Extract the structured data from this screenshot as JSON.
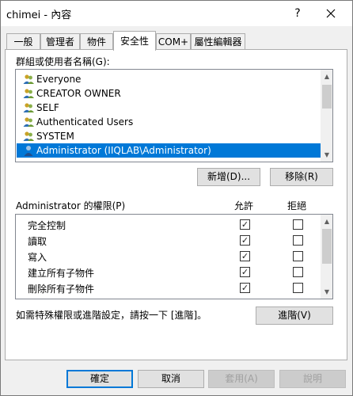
{
  "window": {
    "title": "chimei - 內容",
    "help_glyph": "?",
    "close_glyph": "✕"
  },
  "tabs": [
    {
      "label": "一般",
      "active": false
    },
    {
      "label": "管理者",
      "active": false
    },
    {
      "label": "物件",
      "active": false
    },
    {
      "label": "安全性",
      "active": true
    },
    {
      "label": "COM+",
      "active": false
    },
    {
      "label": "屬性編輯器",
      "active": false
    }
  ],
  "security": {
    "groups_label": "群組或使用者名稱(G):",
    "principals": [
      {
        "name": "Everyone",
        "icon": "group-users-icon",
        "selected": false
      },
      {
        "name": "CREATOR OWNER",
        "icon": "group-users-icon",
        "selected": false
      },
      {
        "name": "SELF",
        "icon": "group-users-icon",
        "selected": false
      },
      {
        "name": "Authenticated Users",
        "icon": "group-users-icon",
        "selected": false
      },
      {
        "name": "SYSTEM",
        "icon": "group-users-icon",
        "selected": false
      },
      {
        "name": "Administrator (IIQLAB\\Administrator)",
        "icon": "user-icon",
        "selected": true
      }
    ],
    "add_button": "新增(D)...",
    "remove_button": "移除(R)",
    "permissions_for_label": "Administrator 的權限(P)",
    "allow_header": "允許",
    "deny_header": "拒絕",
    "permissions": [
      {
        "name": "完全控制",
        "allow": true,
        "deny": false
      },
      {
        "name": "讀取",
        "allow": true,
        "deny": false
      },
      {
        "name": "寫入",
        "allow": true,
        "deny": false
      },
      {
        "name": "建立所有子物件",
        "allow": true,
        "deny": false
      },
      {
        "name": "刪除所有子物件",
        "allow": true,
        "deny": false
      }
    ],
    "advanced_hint": "如需特殊權限或進階設定，請按一下 [進階]。",
    "advanced_button": "進階(V)"
  },
  "footer": {
    "ok": "確定",
    "cancel": "取消",
    "apply": "套用(A)",
    "help": "說明"
  },
  "colors": {
    "selection": "#0078d7",
    "button_face": "#e1e1e1",
    "disabled_text": "#a0a0a0"
  }
}
